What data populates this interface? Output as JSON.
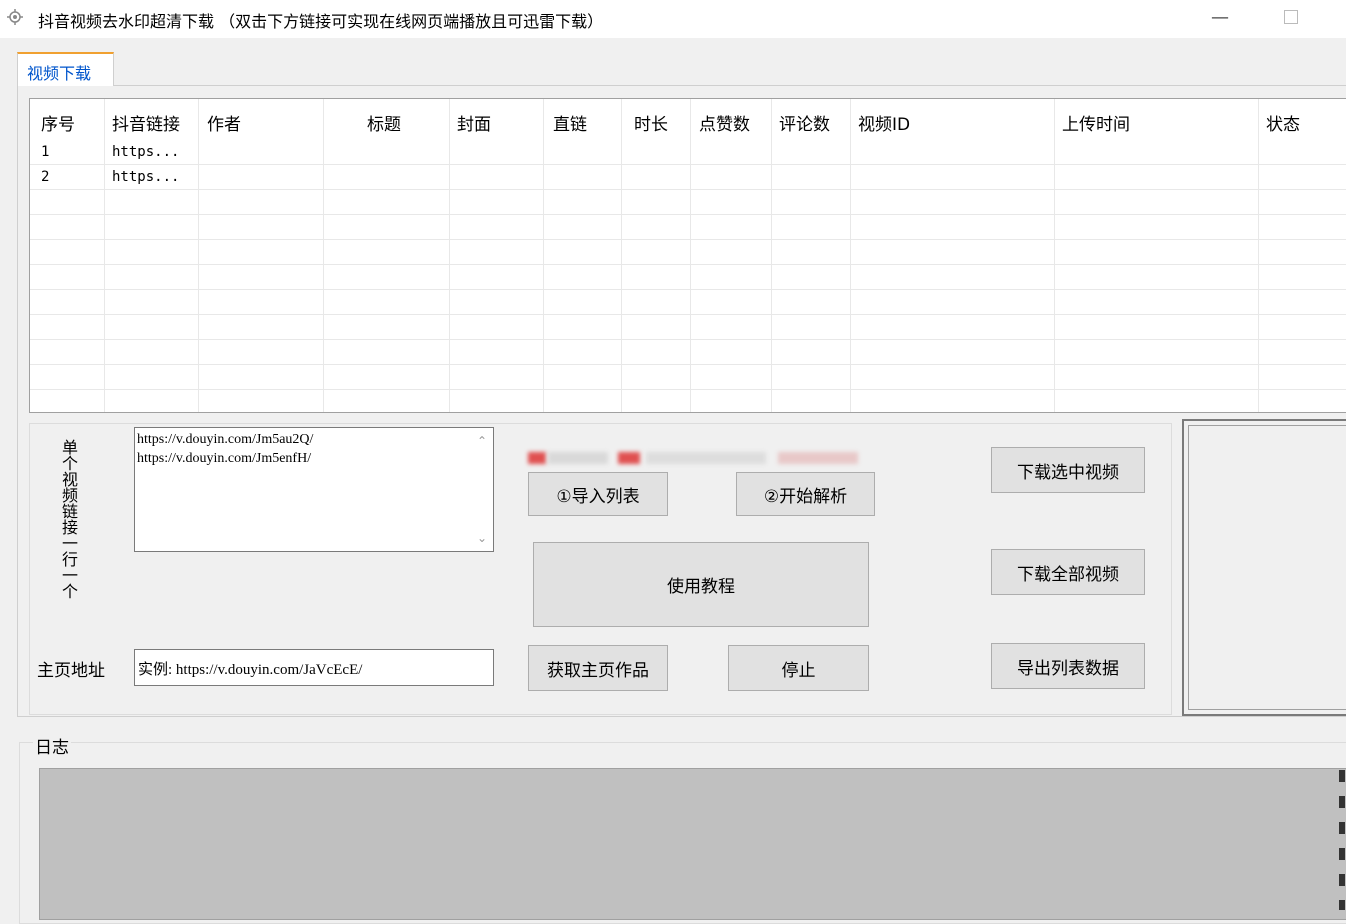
{
  "window": {
    "title": "抖音视频去水印超清下载 （双击下方链接可实现在线网页端播放且可迅雷下载）",
    "minimize_glyph": "—",
    "icon": "gear-icon"
  },
  "tabs": [
    {
      "label": "视频下载",
      "selected": true
    }
  ],
  "table": {
    "columns": [
      "序号",
      "抖音链接",
      "作者",
      "标题",
      "封面",
      "直链",
      "时长",
      "点赞数",
      "评论数",
      "视频ID",
      "上传时间",
      "状态"
    ],
    "rows": [
      [
        "1",
        "https...",
        "",
        "",
        "",
        "",
        "",
        "",
        "",
        "",
        "",
        ""
      ],
      [
        "2",
        "https...",
        "",
        "",
        "",
        "",
        "",
        "",
        "",
        "",
        "",
        ""
      ]
    ]
  },
  "single_links": {
    "label": "单个视频链接一行一个",
    "label_chars": [
      "单个",
      "视频",
      "链接",
      "一行",
      "一个"
    ],
    "value": "https://v.douyin.com/Jm5au2Q/\nhttps://v.douyin.com/Jm5enfH/"
  },
  "buttons": {
    "import_list": "①导入列表",
    "start_parse": "②开始解析",
    "tutorial": "使用教程",
    "fetch_home": "获取主页作品",
    "stop": "停止",
    "download_selected": "下载选中视频",
    "download_all": "下载全部视频",
    "export_list": "导出列表数据"
  },
  "homepage": {
    "label": "主页地址",
    "value": "实例: https://v.douyin.com/JaVcEcE/"
  },
  "log": {
    "title": "日志"
  },
  "colors": {
    "tab_accent": "#f0a030",
    "tab_text": "#0055cc",
    "log_bg": "#c0c0c0",
    "blur_red": "#e05050"
  }
}
